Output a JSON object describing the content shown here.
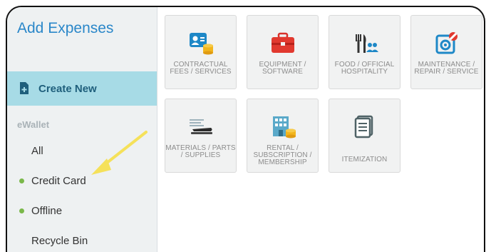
{
  "sidebar": {
    "title": "Add Expenses",
    "create_new": "Create New",
    "section": "eWallet",
    "items": [
      {
        "label": "All",
        "dot": false
      },
      {
        "label": "Credit Card",
        "dot": true
      },
      {
        "label": "Offline",
        "dot": true
      },
      {
        "label": "Recycle Bin",
        "dot": false
      }
    ]
  },
  "tiles": [
    {
      "label": "CONTRACTUAL FEES / SERVICES",
      "icon": "contract-person-coins-icon"
    },
    {
      "label": "EQUIPMENT / SOFTWARE",
      "icon": "toolbox-icon"
    },
    {
      "label": "FOOD / OFFICIAL HOSPITALITY",
      "icon": "food-utensils-people-icon"
    },
    {
      "label": "MAINTENANCE / REPAIR / SERVICE",
      "icon": "maintenance-wrench-icon"
    },
    {
      "label": "MATERIALS / PARTS / SUPPLIES",
      "icon": "stapler-paper-icon"
    },
    {
      "label": "RENTAL / SUBSCRIPTION / MEMBERSHIP",
      "icon": "building-coins-icon"
    },
    {
      "label": "ITEMIZATION",
      "icon": "itemization-docs-icon"
    }
  ],
  "colors": {
    "title": "#2a87c9",
    "create_new_bg": "#a7dbe6",
    "dot": "#7ab84a",
    "arrow": "#f5e15a"
  }
}
